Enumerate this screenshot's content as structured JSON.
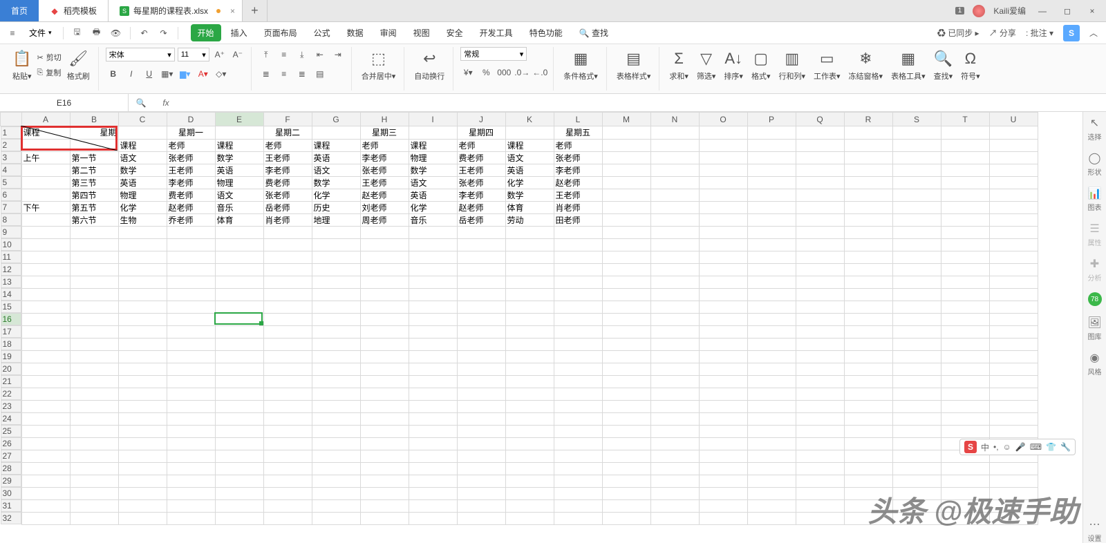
{
  "titlebar": {
    "home": "首页",
    "template": "稻壳模板",
    "filename": "每星期的课程表.xlsx",
    "badge": "1",
    "username": "Kaili爱编"
  },
  "menubar": {
    "file": "文件",
    "tabs": [
      "开始",
      "插入",
      "页面布局",
      "公式",
      "数据",
      "审阅",
      "视图",
      "安全",
      "开发工具",
      "特色功能"
    ],
    "search": "查找",
    "synced": "已同步",
    "share": "分享",
    "approve": "批注"
  },
  "ribbon": {
    "paste": "粘贴",
    "cut": "剪切",
    "copy": "复制",
    "fmtpaint": "格式刷",
    "font": "宋体",
    "size": "11",
    "number": "常规",
    "mergecenter": "合并居中",
    "wrap": "自动换行",
    "condfmt": "条件格式",
    "tablestyle": "表格样式",
    "sum": "求和",
    "filter": "筛选",
    "sort": "排序",
    "format": "格式",
    "rowcol": "行和列",
    "worksheet": "工作表",
    "freeze": "冻结窗格",
    "tabletool": "表格工具",
    "findr": "查找",
    "symbol": "符号"
  },
  "fbar": {
    "name": "E16",
    "fx": "fx"
  },
  "columns": [
    "A",
    "B",
    "C",
    "D",
    "E",
    "F",
    "G",
    "H",
    "I",
    "J",
    "K",
    "L",
    "M",
    "N",
    "O",
    "P",
    "Q",
    "R",
    "S",
    "T",
    "U"
  ],
  "rowcount": 32,
  "data": {
    "diag_top": "课程",
    "diag_bot": "星期",
    "days": [
      "星期一",
      "星期二",
      "星期三",
      "星期四",
      "星期五"
    ],
    "hdr_course": "课程",
    "hdr_teacher": "老师",
    "am": "上午",
    "pm": "下午",
    "periods": [
      "第一节",
      "第二节",
      "第三节",
      "第四节",
      "第五节",
      "第六节"
    ],
    "rows": [
      [
        "语文",
        "张老师",
        "数学",
        "王老师",
        "英语",
        "李老师",
        "物理",
        "费老师",
        "语文",
        "张老师"
      ],
      [
        "数学",
        "王老师",
        "英语",
        "李老师",
        "语文",
        "张老师",
        "数学",
        "王老师",
        "英语",
        "李老师"
      ],
      [
        "英语",
        "李老师",
        "物理",
        "费老师",
        "数学",
        "王老师",
        "语文",
        "张老师",
        "化学",
        "赵老师"
      ],
      [
        "物理",
        "费老师",
        "语文",
        "张老师",
        "化学",
        "赵老师",
        "英语",
        "李老师",
        "数学",
        "王老师"
      ],
      [
        "化学",
        "赵老师",
        "音乐",
        "岳老师",
        "历史",
        "刘老师",
        "化学",
        "赵老师",
        "体育",
        "肖老师"
      ],
      [
        "生物",
        "乔老师",
        "体育",
        "肖老师",
        "地理",
        "周老师",
        "音乐",
        "岳老师",
        "劳动",
        "田老师"
      ]
    ]
  },
  "sidebar": {
    "select": "选择",
    "shape": "形状",
    "chart": "图表",
    "prop": "属性",
    "analysis": "分析",
    "score": "78",
    "gallery": "图库",
    "style": "风格",
    "settings": "设置"
  },
  "ime": {
    "zhong": "中"
  },
  "watermark": "头条 @极速手助"
}
